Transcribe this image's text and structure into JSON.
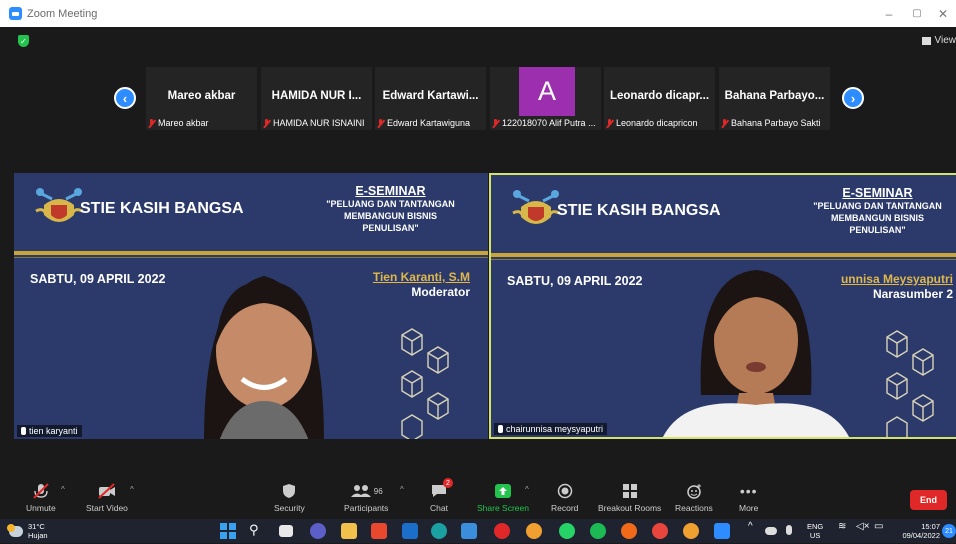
{
  "window": {
    "title": "Zoom Meeting",
    "min": "–",
    "max": "▢",
    "close": "✕"
  },
  "top": {
    "view_label": "View"
  },
  "gallery": [
    {
      "name": "Mareo akbar",
      "label": "Mareo akbar"
    },
    {
      "name": "HAMIDA NUR I...",
      "label": "HAMIDA NUR ISNAINI"
    },
    {
      "name": "Edward Kartawi...",
      "label": "Edward Kartawiguna"
    },
    {
      "name": "A",
      "label": "122018070 Alif Putra ..."
    },
    {
      "name": "Leonardo dicapr...",
      "label": "Leonardo dicapricon"
    },
    {
      "name": "Bahana Parbayo...",
      "label": "Bahana Parbayo Sakti"
    }
  ],
  "slides": {
    "school": "STIE KASIH BANGSA",
    "seminar_head": "E-SEMINAR",
    "seminar_line1": "\"PELUANG DAN TANTANGAN",
    "seminar_line2": "MEMBANGUN BISNIS",
    "seminar_line3": "PENULISAN\"",
    "date": "SABTU, 09 APRIL 2022"
  },
  "videos": [
    {
      "speaker": "Tien Karanti, S.M",
      "role": "Moderator",
      "label": "tien karyanti"
    },
    {
      "speaker": "unnisa Meysyaputri",
      "role": "Narasumber 2",
      "label": "chairunnisa meysyaputri"
    }
  ],
  "toolbar": {
    "unmute": "Unmute",
    "start_video": "Start Video",
    "security": "Security",
    "participants": "Participants",
    "participants_count": "96",
    "chat": "Chat",
    "chat_badge": "2",
    "share_screen": "Share Screen",
    "record": "Record",
    "breakout": "Breakout Rooms",
    "reactions": "Reactions",
    "more": "More",
    "end": "End"
  },
  "taskbar": {
    "temp": "31°C",
    "weather": "Hujan",
    "lang1": "ENG",
    "lang2": "US",
    "time": "15:07",
    "date": "09/04/2022",
    "notif": "21"
  },
  "colors": {
    "accent": "#2d8cff",
    "end": "#e02828",
    "slide_bg": "#2b3a6b",
    "gold": "#c9a538",
    "active_border": "#d4e26a"
  }
}
